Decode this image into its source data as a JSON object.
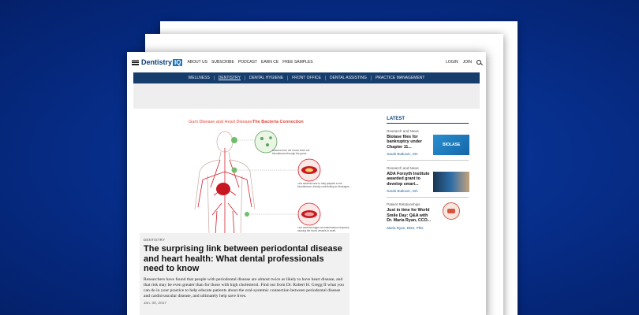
{
  "colors": {
    "background": "#062c86",
    "nav_bar": "#173d6c",
    "brand_blue": "#1a73b8",
    "accent_red": "#e0473a"
  },
  "header": {
    "logo_text": "Dentistry",
    "logo_badge": "IQ",
    "links": [
      "ABOUT US",
      "SUBSCRIBE",
      "PODCAST",
      "EARN CE",
      "FREE SAMPLES"
    ],
    "login": "LOGIN",
    "join": "JOIN"
  },
  "nav": {
    "items": [
      "WELLNESS",
      "DENTISTRY",
      "DENTAL HYGIENE",
      "FRONT OFFICE",
      "DENTAL ASSISTING",
      "PRACTICE MANAGEMENT"
    ],
    "active": "DENTISTRY"
  },
  "hero": {
    "image_title_part1": "Gum Disease and Heart Disease:",
    "image_title_part2": "The Bacteria Connection",
    "caption1": "Bacteria from the mouth enter the bloodstream through the gums.",
    "caption2": "Oral bacteria stick to fatty plaques in the bloodstream, directly contributing to blockages.",
    "caption3": "Oral bacteria trigger an inflammation response, causing the blood vessels to swell."
  },
  "article": {
    "category": "DENTISTRY",
    "headline": "The surprising link between periodontal disease and heart health: What dental professionals need to know",
    "summary": "Researchers have found that people with periodontal disease are almost twice as likely to have heart disease, and that risk may be even greater than for those with high cholesterol. Find out from Dr. Robert H. Gregg II what you can do in your practice to help educate patients about the oral-systemic connection between periodontal disease and cardiovascular disease, and ultimately help save lives.",
    "date": "Jan. 30, 2017"
  },
  "sidebar": {
    "title": "LATEST",
    "items": [
      {
        "category": "Research and News",
        "title": "Biolase files for bankruptcy under Chapter 11...",
        "author": "Sarah Butkovic, MA",
        "thumb": "BIOLASE"
      },
      {
        "category": "Research and News",
        "title": "ADA Forsyth Institute awarded grant to develop smart...",
        "author": "Sarah Butkovic, MA",
        "thumb": ""
      },
      {
        "category": "Patient Relationships",
        "title": "Just in time for World Smile Day: Q&A with Dr. Maria Ryan, CCO...",
        "author": "Maria Ryan, DDS, PhD",
        "thumb": ""
      }
    ]
  }
}
